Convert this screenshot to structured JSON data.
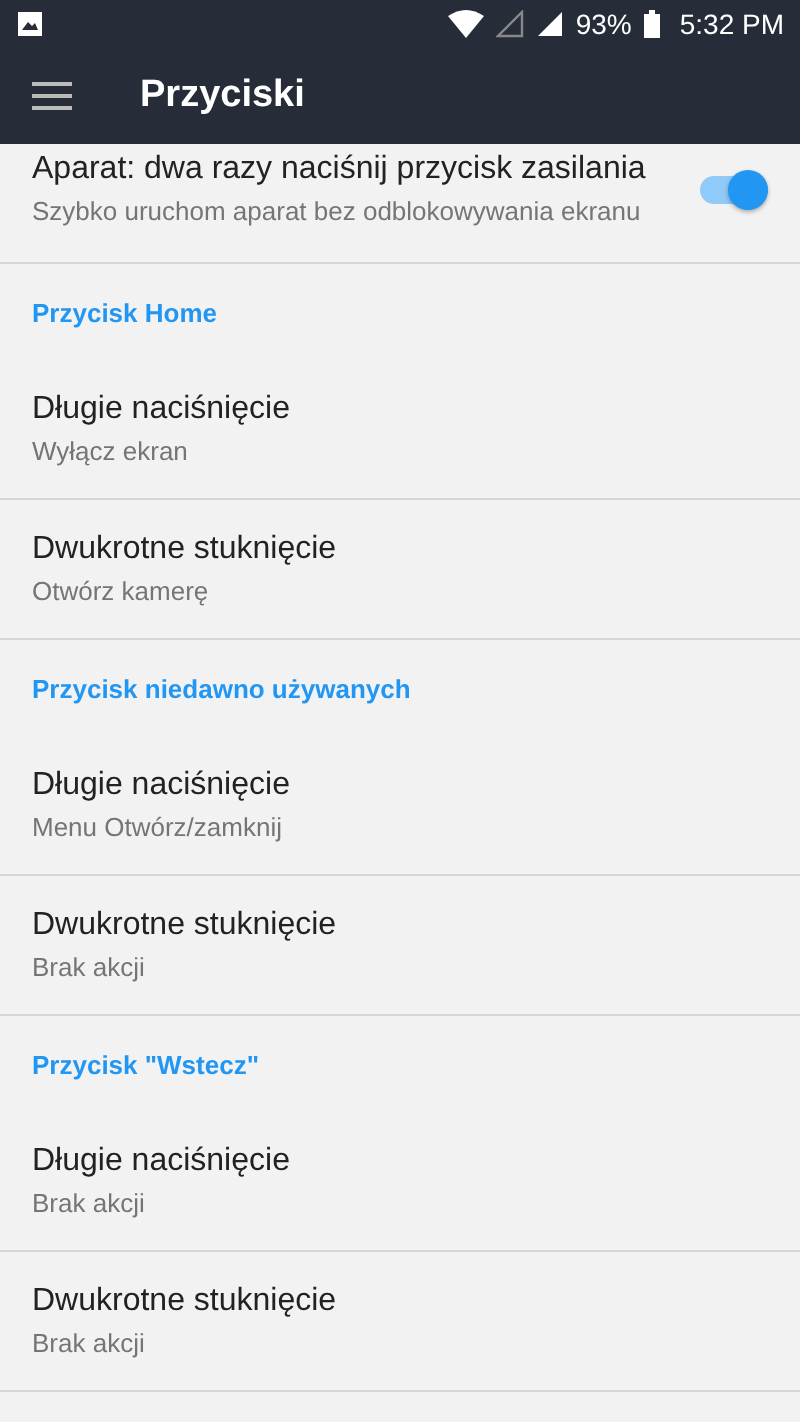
{
  "status_bar": {
    "battery": "93%",
    "time": "5:32 PM"
  },
  "toolbar": {
    "title": "Przyciski"
  },
  "top_item": {
    "title": "Aparat: dwa razy naciśnij przycisk zasilania",
    "subtitle": "Szybko uruchom aparat bez odblokowywania ekranu",
    "on": true
  },
  "sections": [
    {
      "header": "Przycisk Home",
      "items": [
        {
          "title": "Długie naciśnięcie",
          "subtitle": "Wyłącz ekran"
        },
        {
          "title": "Dwukrotne stuknięcie",
          "subtitle": "Otwórz kamerę"
        }
      ]
    },
    {
      "header": "Przycisk niedawno używanych",
      "items": [
        {
          "title": "Długie naciśnięcie",
          "subtitle": "Menu Otwórz/zamknij"
        },
        {
          "title": "Dwukrotne stuknięcie",
          "subtitle": "Brak akcji"
        }
      ]
    },
    {
      "header": "Przycisk \"Wstecz\"",
      "items": [
        {
          "title": "Długie naciśnięcie",
          "subtitle": "Brak akcji"
        },
        {
          "title": "Dwukrotne stuknięcie",
          "subtitle": "Brak akcji"
        }
      ]
    }
  ]
}
